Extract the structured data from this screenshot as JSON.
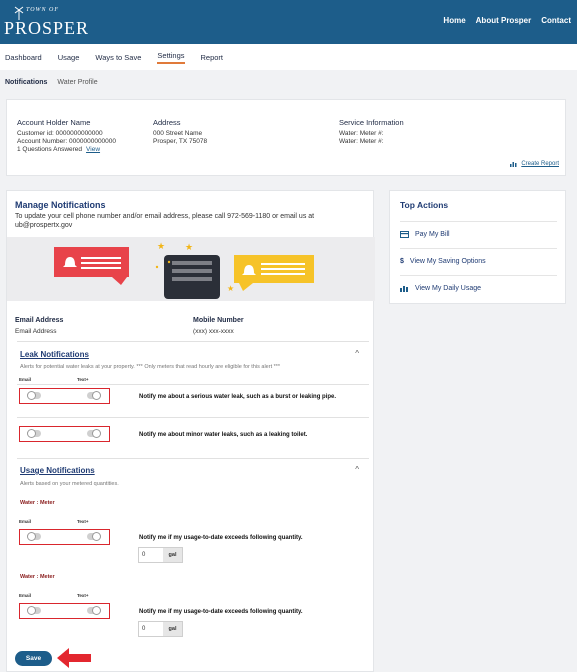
{
  "header": {
    "logo_top": "TOWN OF",
    "logo_name": "PROSPER",
    "nav": [
      "Home",
      "About Prosper",
      "Contact"
    ]
  },
  "subnav": {
    "items": [
      "Dashboard",
      "Usage",
      "Ways to Save",
      "Settings",
      "Report"
    ],
    "active": "Settings"
  },
  "tabs": {
    "items": [
      "Notifications",
      "Water Profile"
    ],
    "active": "Notifications"
  },
  "account": {
    "holder_title": "Account Holder Name",
    "customer_id": "Customer id: 0000000000000",
    "account_number": "Account Number: 0000000000000",
    "questions": "1 Questions Answered",
    "view_link": "View",
    "address_title": "Address",
    "address_line1": "000 Street Name",
    "address_line2": "Prosper, TX 75078",
    "service_title": "Service Information",
    "service_line1": "Water: Meter #:",
    "service_line2": "Water: Meter #:",
    "create_report": "Create Report"
  },
  "manage": {
    "title": "Manage Notifications",
    "description": "To update your cell phone number and/or email address, please call 972-569-1180 or email us at ub@prospertx.gov",
    "email_header": "Email Address",
    "email_value": "Email Address",
    "mobile_header": "Mobile Number",
    "mobile_value": "(xxx) xxx-xxxx"
  },
  "leak": {
    "title": "Leak Notifications",
    "description": "Alerts for potential water leaks at your property. *** Only meters that read hourly are eligible for this alert ***",
    "email_label": "Email",
    "text_label": "Text+",
    "rule1": "Notify me about a serious water leak, such as a burst or leaking pipe.",
    "rule2": "Notify me about minor water leaks, such as a leaking toilet."
  },
  "usage": {
    "title": "Usage Notifications",
    "description": "Alerts based on your metered quantities.",
    "meter_label": "Water : Meter",
    "email_label": "Email",
    "text_label": "Text+",
    "rule": "Notify me if my usage-to-date exceeds following quantity.",
    "quantity": "0",
    "unit": "gal"
  },
  "save_label": "Save",
  "top_actions": {
    "title": "Top Actions",
    "items": [
      {
        "icon": "credit-card-icon",
        "label": "Pay My Bill"
      },
      {
        "icon": "dollar-icon",
        "label": "View My Saving Options"
      },
      {
        "icon": "bar-chart-icon",
        "label": "View My Daily Usage"
      }
    ]
  },
  "colors": {
    "header": "#1d5d8a",
    "title": "#1f3b73",
    "highlight": "#d9262d",
    "tab_underline": "#e07a3a"
  }
}
